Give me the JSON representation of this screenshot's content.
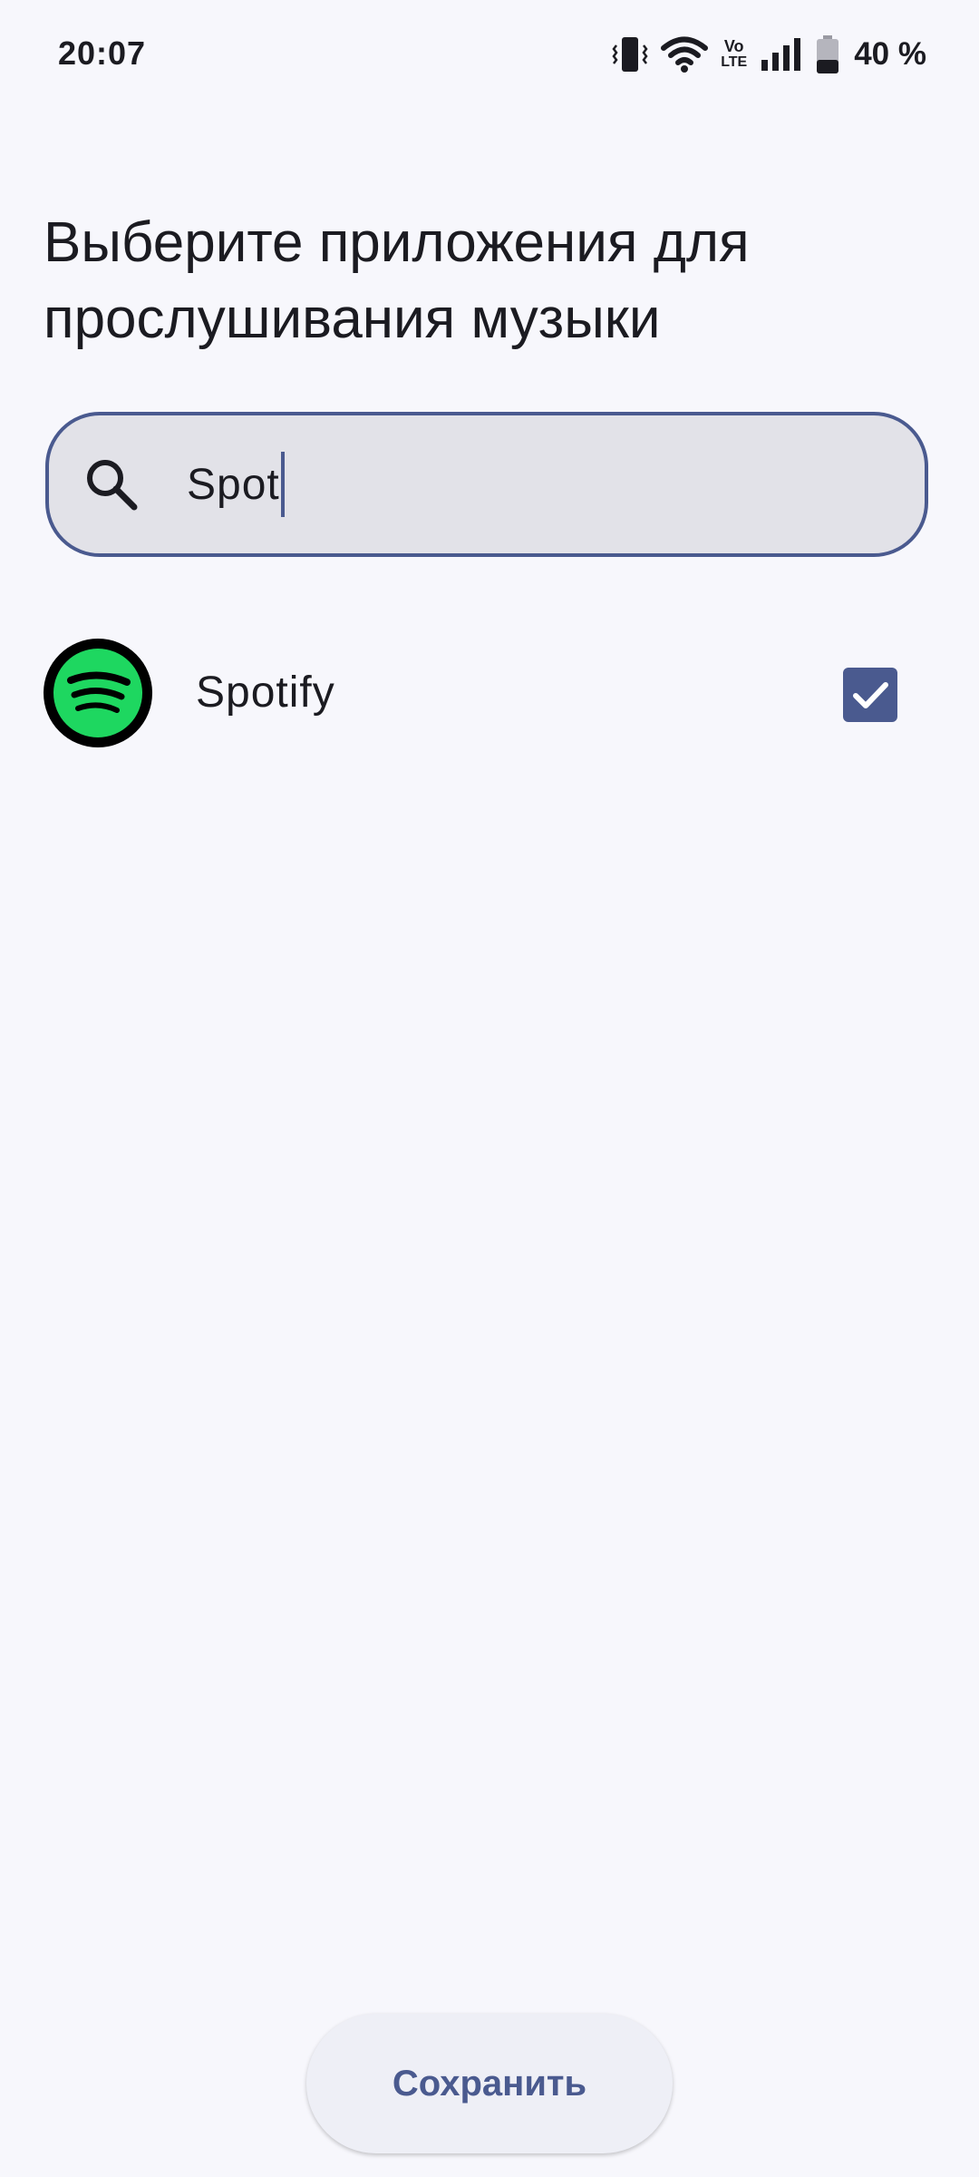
{
  "status_bar": {
    "time": "20:07",
    "icons": [
      "vibrate-icon",
      "wifi-icon",
      "volte-icon",
      "signal-icon",
      "battery-icon"
    ],
    "volte_top": "Vo",
    "volte_bottom": "LTE",
    "battery_percent": "40 %",
    "battery_level": 0.4
  },
  "page": {
    "title_line1": "Выберите приложения для",
    "title_line2": "прослушивания музыки"
  },
  "search": {
    "value": "Spot",
    "icon": "search-icon"
  },
  "apps": [
    {
      "name": "Spotify",
      "icon": "spotify-icon",
      "checked": true
    }
  ],
  "actions": {
    "save_label": "Сохранить"
  },
  "colors": {
    "background": "#f7f7fc",
    "accent": "#4a5a8f",
    "search_fill": "#e2e2e8",
    "spotify_green": "#1ed760"
  }
}
